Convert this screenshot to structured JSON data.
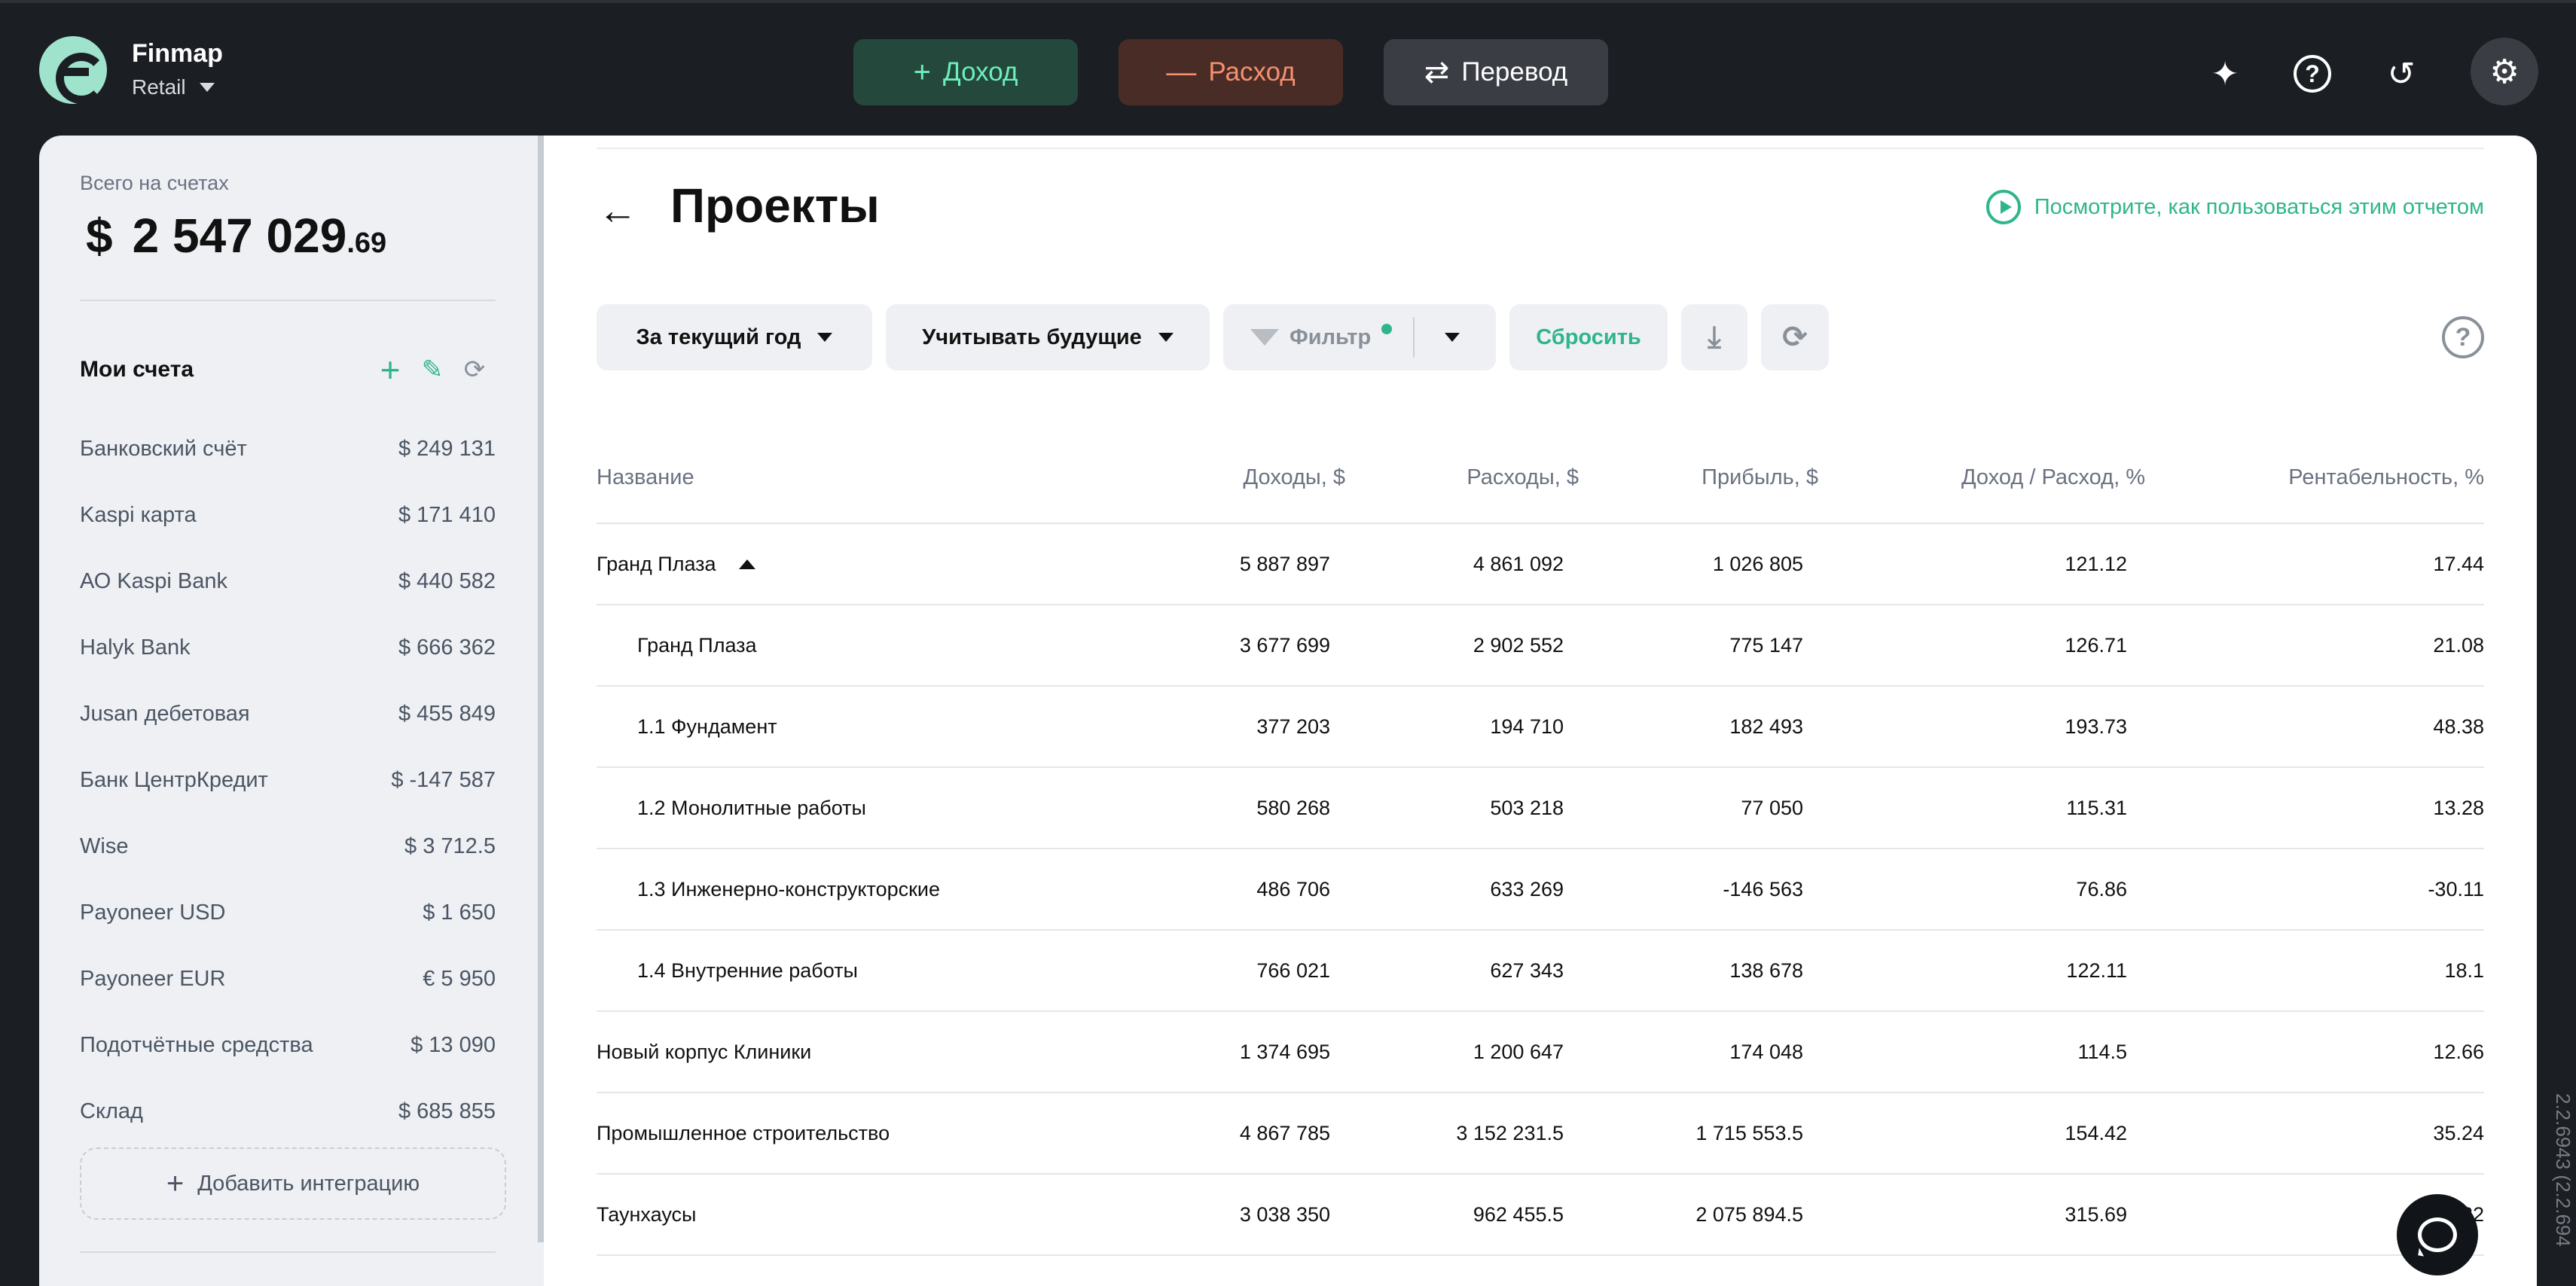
{
  "app": {
    "brand_name": "Finmap",
    "workspace": "Retail"
  },
  "top_actions": {
    "income_label": "Доход",
    "expense_label": "Расход",
    "transfer_label": "Перевод",
    "income_icon": "plus-icon",
    "expense_icon": "minus-icon",
    "transfer_icon": "arrows-swap-icon"
  },
  "top_icons": [
    "sparkle-icon",
    "help-icon",
    "history-icon",
    "gear-icon"
  ],
  "sidebar": {
    "total_label": "Всего на счетах",
    "total_currency": "$",
    "total_main": "2 547 029",
    "total_cents": ".69",
    "accounts_title": "Мои счета",
    "accounts": [
      {
        "name": "Банковский счёт",
        "amount": "$  249 131"
      },
      {
        "name": "Kaspi карта",
        "amount": "$  171 410"
      },
      {
        "name": "АО Kaspi Bank",
        "amount": "$  440 582"
      },
      {
        "name": "Halyk Bank",
        "amount": "$  666 362"
      },
      {
        "name": "Jusan дебетовая",
        "amount": "$  455 849"
      },
      {
        "name": "Банк ЦентрКредит",
        "amount": "$  -147 587"
      },
      {
        "name": "Wise",
        "amount": "$  3 712.5"
      },
      {
        "name": "Payoneer USD",
        "amount": "$  1 650"
      },
      {
        "name": "Payoneer EUR",
        "amount": "€  5 950"
      },
      {
        "name": "Подотчётные средства",
        "amount": "$  13 090"
      },
      {
        "name": "Склад",
        "amount": "$  685 855"
      }
    ],
    "add_integration_label": "Добавить интеграцию"
  },
  "report": {
    "title": "Проекты",
    "howto_link": "Посмотрите, как пользоваться этим отчетом",
    "filters": {
      "period": "За текущий год",
      "future": "Учитывать будущие",
      "filter": "Фильтр",
      "reset": "Сбросить"
    },
    "columns": [
      "Название",
      "Доходы, $",
      "Расходы, $",
      "Прибыль, $",
      "Доход / Расход, %",
      "Рентабельность, %"
    ],
    "rows": [
      {
        "name": "Гранд Плаза",
        "income": "5 887 897",
        "expense": "4 861 092",
        "profit": "1 026 805",
        "ratio": "121.12",
        "rent": "17.44",
        "level": 0,
        "expanded": true
      },
      {
        "name": "Гранд Плаза",
        "income": "3 677 699",
        "expense": "2 902 552",
        "profit": "775 147",
        "ratio": "126.71",
        "rent": "21.08",
        "level": 1
      },
      {
        "name": "1.1 Фундамент",
        "income": "377 203",
        "expense": "194 710",
        "profit": "182 493",
        "ratio": "193.73",
        "rent": "48.38",
        "level": 1
      },
      {
        "name": "1.2 Монолитные работы",
        "income": "580 268",
        "expense": "503 218",
        "profit": "77 050",
        "ratio": "115.31",
        "rent": "13.28",
        "level": 1
      },
      {
        "name": "1.3 Инженерно-конструкторские",
        "income": "486 706",
        "expense": "633 269",
        "profit": "-146 563",
        "ratio": "76.86",
        "rent": "-30.11",
        "level": 1
      },
      {
        "name": "1.4 Внутренние работы",
        "income": "766 021",
        "expense": "627 343",
        "profit": "138 678",
        "ratio": "122.11",
        "rent": "18.1",
        "level": 1
      },
      {
        "name": "Новый корпус Клиники",
        "income": "1 374 695",
        "expense": "1 200 647",
        "profit": "174 048",
        "ratio": "114.5",
        "rent": "12.66",
        "level": 0
      },
      {
        "name": "Промышленное строительство",
        "income": "4 867 785",
        "expense": "3 152 231.5",
        "profit": "1 715 553.5",
        "ratio": "154.42",
        "rent": "35.24",
        "level": 0
      },
      {
        "name": "Таунхаусы",
        "income": "3 038 350",
        "expense": "962 455.5",
        "profit": "2 075 894.5",
        "ratio": "315.69",
        "rent": "...32",
        "level": 0
      }
    ]
  },
  "version_text": "2.2.6943 (2.2.694",
  "colors": {
    "accent_green": "#2fb58c",
    "income_text": "#6cf0bb",
    "expense_text": "#f5906f",
    "topbar_bg": "#1b1f24"
  }
}
